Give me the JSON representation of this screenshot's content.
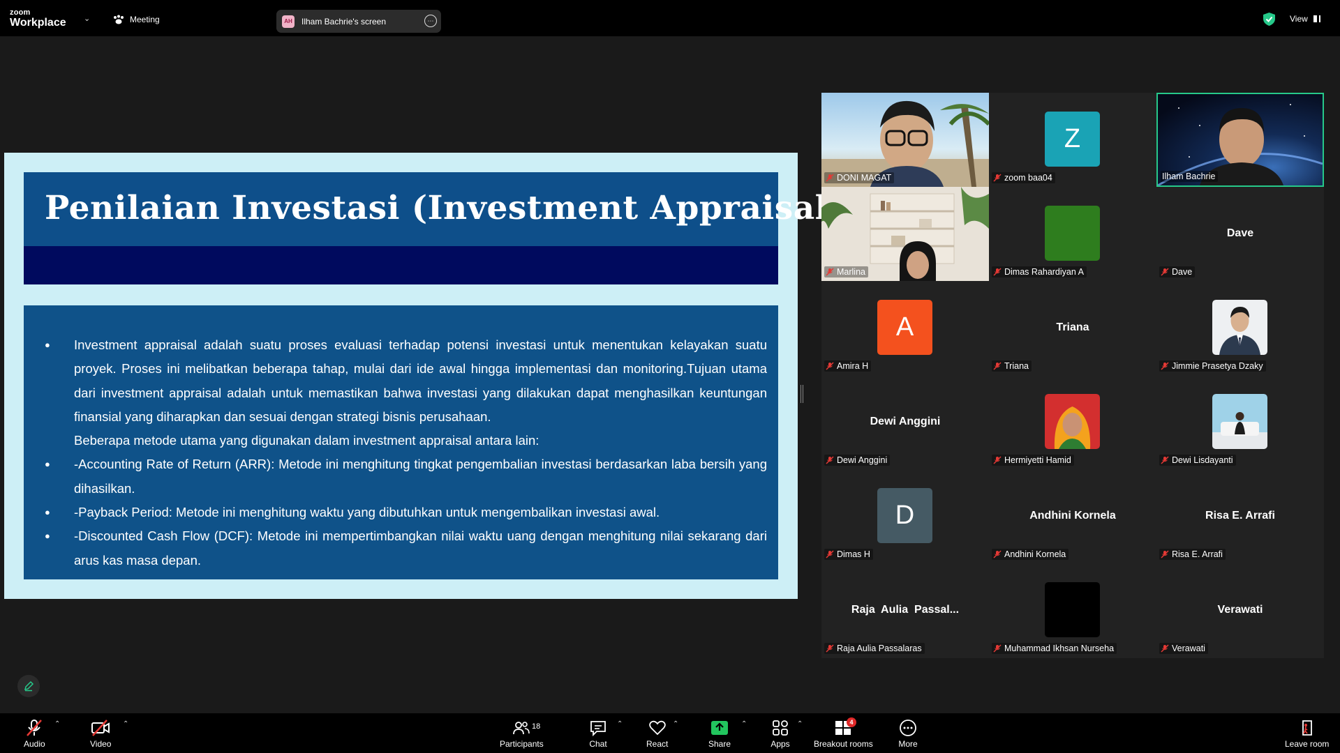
{
  "app": {
    "brand_small": "zoom",
    "brand_large": "Workplace"
  },
  "topbar": {
    "meeting_label": "Meeting",
    "screen_share": {
      "initials": "AH",
      "label": "Ilham Bachrie's screen"
    },
    "view_label": "View"
  },
  "slide": {
    "title": "Penilaian Investasi (Investment Appraisal)",
    "paragraphs": [
      "Investment appraisal adalah suatu proses evaluasi terhadap potensi investasi untuk menentukan kelayakan suatu proyek. Proses ini melibatkan beberapa tahap, mulai dari ide awal hingga implementasi dan monitoring.Tujuan utama dari investment appraisal adalah untuk memastikan bahwa investasi yang dilakukan dapat menghasilkan keuntungan finansial yang diharapkan dan sesuai dengan strategi bisnis perusahaan.",
      "Beberapa metode utama yang digunakan dalam investment appraisal antara lain:",
      "-Accounting Rate of Return (ARR): Metode ini menghitung tingkat pengembalian investasi berdasarkan laba bersih yang dihasilkan.",
      "-Payback Period: Metode ini menghitung waktu yang dibutuhkan untuk mengembalikan investasi awal.",
      "-Discounted Cash Flow (DCF): Metode ini mempertimbangkan nilai waktu uang dengan menghitung nilai sekarang dari arus kas masa depan."
    ]
  },
  "participants": [
    {
      "name": "DONI MAGAT",
      "type": "video-beach"
    },
    {
      "name": "zoom baa04",
      "type": "avatar",
      "letter": "Z",
      "color": "#1aa3b5"
    },
    {
      "name": "Ilham Bachrie",
      "type": "video-space",
      "active": true
    },
    {
      "name": "Marlina",
      "type": "video-shelf"
    },
    {
      "name": "Dimas Rahardiyan A",
      "type": "avatar",
      "letter": "",
      "color": "#2e7d1e"
    },
    {
      "name": "Dave",
      "type": "name",
      "display": "Dave"
    },
    {
      "name": "Amira H",
      "type": "avatar",
      "letter": "A",
      "color": "#f4511e"
    },
    {
      "name": "Triana",
      "type": "name",
      "display": "Triana"
    },
    {
      "name": "Jimmie Prasetya Dzaky",
      "type": "photo-suit"
    },
    {
      "name": "Dewi Anggini",
      "type": "name",
      "display": "Dewi Anggini"
    },
    {
      "name": "Hermiyetti Hamid",
      "type": "photo-hijab"
    },
    {
      "name": "Dewi Lisdayanti",
      "type": "photo-room"
    },
    {
      "name": "Dimas H",
      "type": "avatar",
      "letter": "D",
      "color": "#455a64"
    },
    {
      "name": "Andhini Kornela",
      "type": "name",
      "display": "Andhini Kornela"
    },
    {
      "name": "Risa E. Arrafi",
      "type": "name",
      "display": "Risa E. Arrafi"
    },
    {
      "name": "Raja Aulia Passalaras",
      "type": "name",
      "display": "Raja  Aulia  Passal..."
    },
    {
      "name": "Muhammad Ikhsan Nurseha",
      "type": "avatar",
      "letter": "",
      "color": "#000000"
    },
    {
      "name": "Verawati",
      "type": "name",
      "display": "Verawati"
    }
  ],
  "toolbar": {
    "audio": "Audio",
    "video": "Video",
    "participants": "Participants",
    "participants_count": "18",
    "chat": "Chat",
    "react": "React",
    "share": "Share",
    "apps": "Apps",
    "breakout": "Breakout rooms",
    "breakout_badge": "4",
    "more": "More",
    "leave": "Leave room"
  },
  "colors": {
    "accent_green": "#26c98a",
    "slide_bg": "#cdeff6",
    "slide_blue": "#0f5289",
    "slide_navy": "#000a5e",
    "alert_red": "#e02828"
  }
}
